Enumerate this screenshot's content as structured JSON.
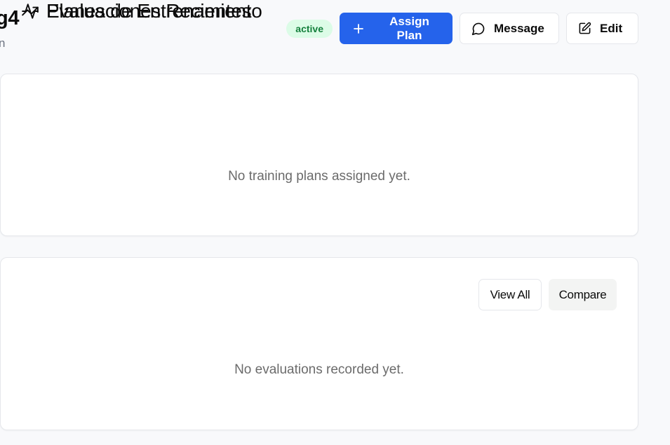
{
  "header": {
    "title": "g4",
    "subtitle": "n",
    "status_badge": "active",
    "actions": {
      "assign_plan": "Assign Plan",
      "message": "Message",
      "edit": "Edit"
    }
  },
  "training_plans": {
    "title": "Planes de Entrenamiento",
    "icon": "activity-icon",
    "empty_text": "No training plans assigned yet."
  },
  "evaluations": {
    "title": "Evaluaciones Recientes",
    "icon": "trending-up-icon",
    "view_all": "View All",
    "compare": "Compare",
    "empty_text": "No evaluations recorded yet."
  },
  "colors": {
    "primary": "#2563eb",
    "badge_bg": "#dcfce7",
    "badge_text": "#15803d",
    "background": "#f8f9fb"
  }
}
